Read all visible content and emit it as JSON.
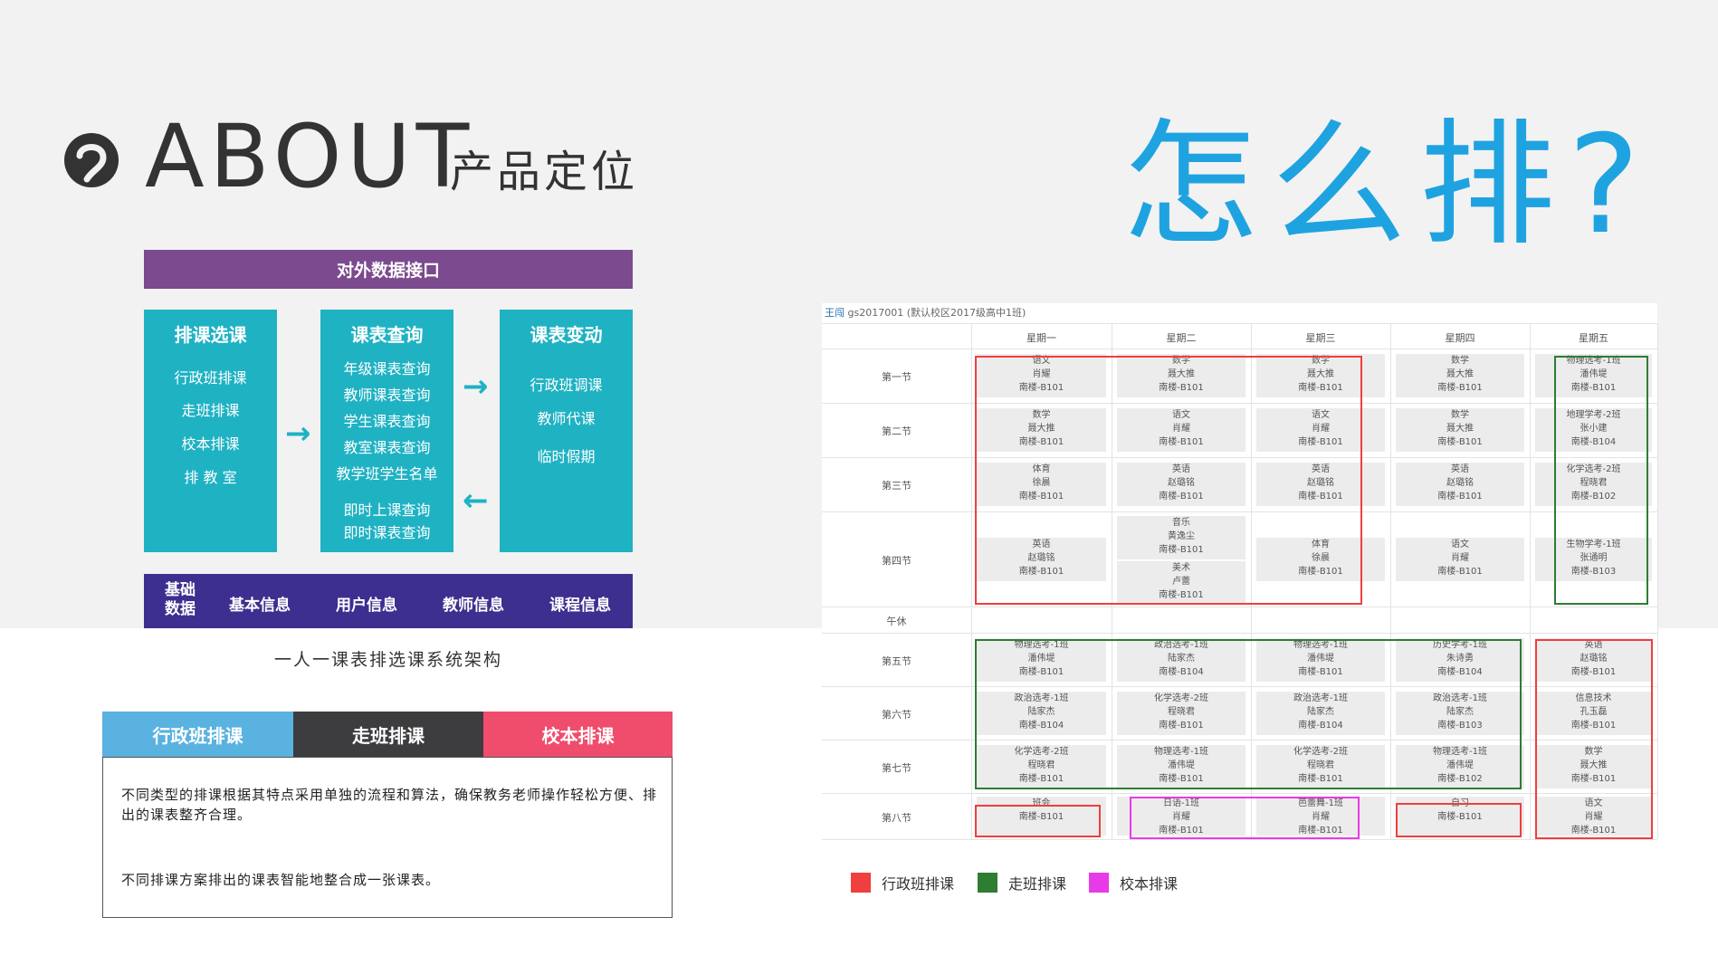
{
  "header": {
    "about": "ABOUT",
    "about_sub": "产品定位",
    "howto": "怎么排?"
  },
  "architecture": {
    "top_bar": "对外数据接口",
    "columns": [
      {
        "title": "排课选课",
        "items": [
          "行政班排课",
          "走班排课",
          "校本排课",
          "排 教 室"
        ]
      },
      {
        "title": "课表查询",
        "items": [
          "年级课表查询",
          "教师课表查询",
          "学生课表查询",
          "教室课表查询",
          "教学班学生名单",
          "即时上课查询",
          "即时课表查询"
        ]
      },
      {
        "title": "课表变动",
        "items": [
          "行政班调课",
          "教师代课",
          "临时假期"
        ]
      }
    ],
    "base_label": "基础\n数据",
    "base_items": [
      "基本信息",
      "用户信息",
      "教师信息",
      "课程信息"
    ],
    "caption": "一人一课表排选课系统架构",
    "colors": {
      "top": "#7c4a8e",
      "column": "#1fb2c3",
      "base": "#3d2f8f"
    }
  },
  "tabs": {
    "items": [
      {
        "label": "行政班排课",
        "color": "#5ab2e0"
      },
      {
        "label": "走班排课",
        "color": "#3d3d3f"
      },
      {
        "label": "校本排课",
        "color": "#f04c6c"
      }
    ],
    "para1": "不同类型的排课根据其特点采用单独的流程和算法，确保教务老师操作轻松方便、排出的课表整齐合理。",
    "para2": "不同排课方案排出的课表智能地整合成一张课表。"
  },
  "timetable": {
    "header_name": "王闯",
    "header_info": "gs2017001 (默认校区2017级高中1班)",
    "days": [
      "星期一",
      "星期二",
      "星期三",
      "星期四",
      "星期五"
    ],
    "periods": [
      "第一节",
      "第二节",
      "第三节",
      "第四节",
      "午休",
      "第五节",
      "第六节",
      "第七节",
      "第八节"
    ],
    "cells": [
      [
        "语文\n肖耀\n南楼-B101",
        "数学\n聂大推\n南楼-B101",
        "数学\n聂大推\n南楼-B101",
        "数学\n聂大推\n南楼-B101",
        "物理选考-1班\n潘伟堤\n南楼-B101"
      ],
      [
        "数学\n聂大推\n南楼-B101",
        "语文\n肖耀\n南楼-B101",
        "语文\n肖耀\n南楼-B101",
        "数学\n聂大推\n南楼-B101",
        "地理学考-2班\n张小建\n南楼-B104"
      ],
      [
        "体育\n徐晨\n南楼-B101",
        "英语\n赵璐铭\n南楼-B101",
        "英语\n赵璐铭\n南楼-B101",
        "英语\n赵璐铭\n南楼-B101",
        "化学选考-2班\n程晓君\n南楼-B102"
      ],
      [
        "英语\n赵璐铭\n南楼-B101",
        "音乐\n黄逸尘\n南楼-B101|美术\n卢蕾\n南楼-B101",
        "体育\n徐晨\n南楼-B101",
        "语文\n肖耀\n南楼-B101",
        "生物学考-1班\n张通明\n南楼-B103"
      ],
      [
        "",
        "",
        "",
        "",
        ""
      ],
      [
        "物理选考-1班\n潘伟堤\n南楼-B101",
        "政治选考-1班\n陆家杰\n南楼-B104",
        "物理选考-1班\n潘伟堤\n南楼-B101",
        "历史学考-1班\n朱诗勇\n南楼-B104",
        "英语\n赵璐铭\n南楼-B101"
      ],
      [
        "政治选考-1班\n陆家杰\n南楼-B104",
        "化学选考-2班\n程晓君\n南楼-B101",
        "政治选考-1班\n陆家杰\n南楼-B104",
        "政治选考-1班\n陆家杰\n南楼-B103",
        "信息技术\n孔玉磊\n南楼-B101"
      ],
      [
        "化学选考-2班\n程晓君\n南楼-B101",
        "物理选考-1班\n潘伟堤\n南楼-B101",
        "化学选考-2班\n程晓君\n南楼-B101",
        "物理选考-1班\n潘伟堤\n南楼-B102",
        "数学\n聂大推\n南楼-B101"
      ],
      [
        "班会\n南楼-B101",
        "日语-1班\n肖耀\n南楼-B101",
        "芭蕾舞-1班\n肖耀\n南楼-B101",
        "自习\n南楼-B101",
        "语文\n肖耀\n南楼-B101"
      ]
    ]
  },
  "legend": [
    {
      "label": "行政班排课",
      "color": "#ef3f3f"
    },
    {
      "label": "走班排课",
      "color": "#2e7d32"
    },
    {
      "label": "校本排课",
      "color": "#e83be8"
    }
  ]
}
